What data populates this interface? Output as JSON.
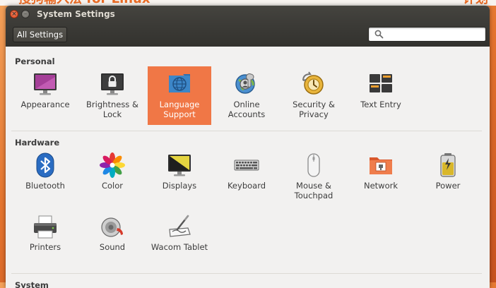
{
  "window": {
    "title": "System Settings"
  },
  "toolbar": {
    "all_settings_label": "All Settings",
    "search_placeholder": "",
    "search_value": ""
  },
  "sections": {
    "personal": {
      "title": "Personal",
      "items": [
        {
          "label": "Appearance",
          "icon": "appearance-icon"
        },
        {
          "label": "Brightness &\nLock",
          "icon": "lock-screen-icon"
        },
        {
          "label": "Language\nSupport",
          "icon": "language-globe-icon",
          "selected": true
        },
        {
          "label": "Online\nAccounts",
          "icon": "online-accounts-icon"
        },
        {
          "label": "Security &\nPrivacy",
          "icon": "security-privacy-icon"
        },
        {
          "label": "Text Entry",
          "icon": "keyboard-layout-icon"
        }
      ]
    },
    "hardware": {
      "title": "Hardware",
      "items": [
        {
          "label": "Bluetooth",
          "icon": "bluetooth-icon"
        },
        {
          "label": "Color",
          "icon": "color-flower-icon"
        },
        {
          "label": "Displays",
          "icon": "display-icon"
        },
        {
          "label": "Keyboard",
          "icon": "keyboard-icon"
        },
        {
          "label": "Mouse &\nTouchpad",
          "icon": "mouse-icon"
        },
        {
          "label": "Network",
          "icon": "network-folder-icon"
        },
        {
          "label": "Power",
          "icon": "battery-icon"
        },
        {
          "label": "Printers",
          "icon": "printer-icon"
        },
        {
          "label": "Sound",
          "icon": "speaker-icon"
        },
        {
          "label": "Wacom Tablet",
          "icon": "tablet-pen-icon"
        }
      ]
    },
    "system": {
      "title": "System"
    }
  },
  "colors": {
    "accent": "#f07746",
    "titlebar": "#3c3b37"
  }
}
